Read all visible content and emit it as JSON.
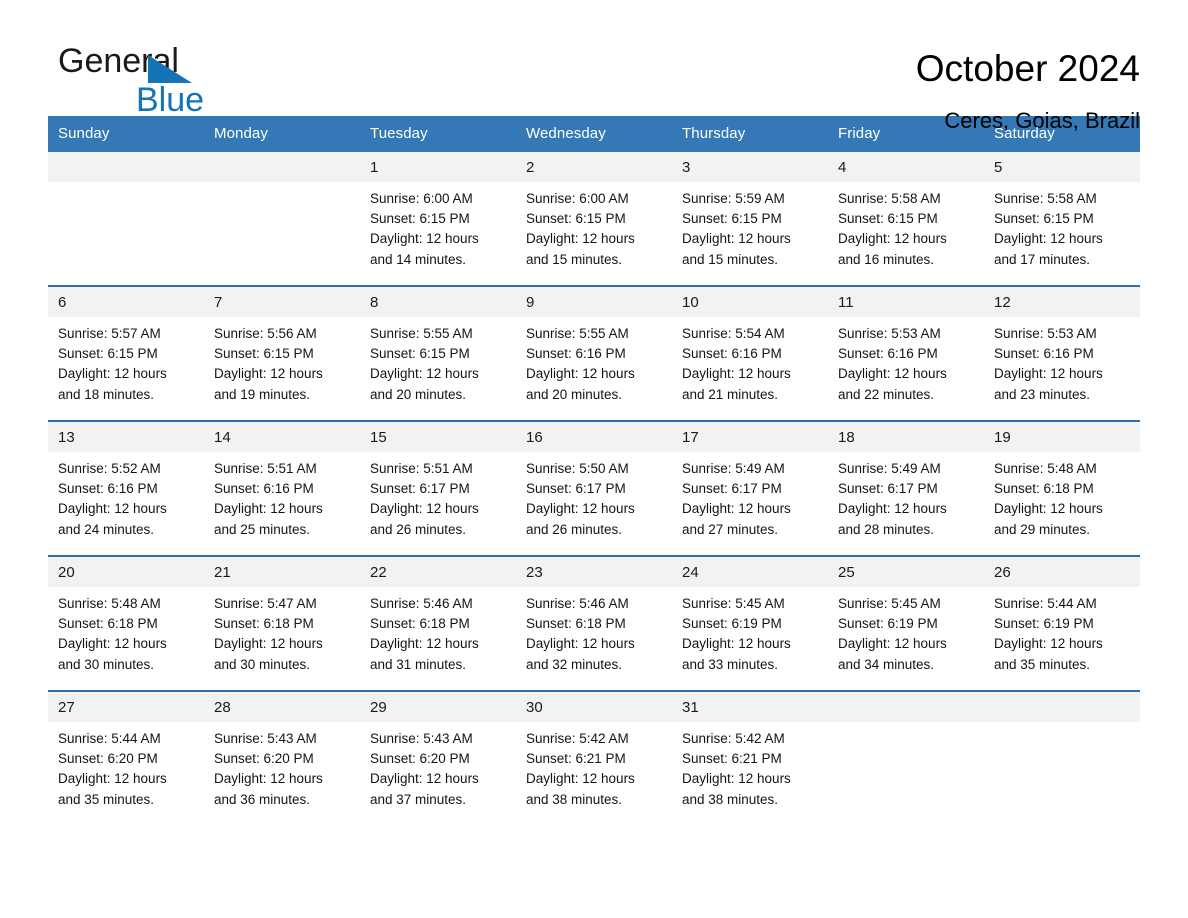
{
  "brand": {
    "name_top": "General",
    "name_bottom": "Blue",
    "triangle_color": "#1574b5",
    "text_color": "#1a1a1a"
  },
  "header": {
    "title": "October 2024",
    "subtitle": "Ceres, Goias, Brazil"
  },
  "theme": {
    "header_bg": "#3479b5",
    "header_text": "#ffffff",
    "week_rule": "#2f6fa8",
    "daynum_bg": "#f2f2f2",
    "body_text": "#141414"
  },
  "calendar": {
    "weekdays": [
      "Sunday",
      "Monday",
      "Tuesday",
      "Wednesday",
      "Thursday",
      "Friday",
      "Saturday"
    ],
    "weeks": [
      {
        "days": [
          {
            "num": "",
            "lines": []
          },
          {
            "num": "",
            "lines": []
          },
          {
            "num": "1",
            "lines": [
              "Sunrise: 6:00 AM",
              "Sunset: 6:15 PM",
              "Daylight: 12 hours",
              "and 14 minutes."
            ]
          },
          {
            "num": "2",
            "lines": [
              "Sunrise: 6:00 AM",
              "Sunset: 6:15 PM",
              "Daylight: 12 hours",
              "and 15 minutes."
            ]
          },
          {
            "num": "3",
            "lines": [
              "Sunrise: 5:59 AM",
              "Sunset: 6:15 PM",
              "Daylight: 12 hours",
              "and 15 minutes."
            ]
          },
          {
            "num": "4",
            "lines": [
              "Sunrise: 5:58 AM",
              "Sunset: 6:15 PM",
              "Daylight: 12 hours",
              "and 16 minutes."
            ]
          },
          {
            "num": "5",
            "lines": [
              "Sunrise: 5:58 AM",
              "Sunset: 6:15 PM",
              "Daylight: 12 hours",
              "and 17 minutes."
            ]
          }
        ]
      },
      {
        "days": [
          {
            "num": "6",
            "lines": [
              "Sunrise: 5:57 AM",
              "Sunset: 6:15 PM",
              "Daylight: 12 hours",
              "and 18 minutes."
            ]
          },
          {
            "num": "7",
            "lines": [
              "Sunrise: 5:56 AM",
              "Sunset: 6:15 PM",
              "Daylight: 12 hours",
              "and 19 minutes."
            ]
          },
          {
            "num": "8",
            "lines": [
              "Sunrise: 5:55 AM",
              "Sunset: 6:15 PM",
              "Daylight: 12 hours",
              "and 20 minutes."
            ]
          },
          {
            "num": "9",
            "lines": [
              "Sunrise: 5:55 AM",
              "Sunset: 6:16 PM",
              "Daylight: 12 hours",
              "and 20 minutes."
            ]
          },
          {
            "num": "10",
            "lines": [
              "Sunrise: 5:54 AM",
              "Sunset: 6:16 PM",
              "Daylight: 12 hours",
              "and 21 minutes."
            ]
          },
          {
            "num": "11",
            "lines": [
              "Sunrise: 5:53 AM",
              "Sunset: 6:16 PM",
              "Daylight: 12 hours",
              "and 22 minutes."
            ]
          },
          {
            "num": "12",
            "lines": [
              "Sunrise: 5:53 AM",
              "Sunset: 6:16 PM",
              "Daylight: 12 hours",
              "and 23 minutes."
            ]
          }
        ]
      },
      {
        "days": [
          {
            "num": "13",
            "lines": [
              "Sunrise: 5:52 AM",
              "Sunset: 6:16 PM",
              "Daylight: 12 hours",
              "and 24 minutes."
            ]
          },
          {
            "num": "14",
            "lines": [
              "Sunrise: 5:51 AM",
              "Sunset: 6:16 PM",
              "Daylight: 12 hours",
              "and 25 minutes."
            ]
          },
          {
            "num": "15",
            "lines": [
              "Sunrise: 5:51 AM",
              "Sunset: 6:17 PM",
              "Daylight: 12 hours",
              "and 26 minutes."
            ]
          },
          {
            "num": "16",
            "lines": [
              "Sunrise: 5:50 AM",
              "Sunset: 6:17 PM",
              "Daylight: 12 hours",
              "and 26 minutes."
            ]
          },
          {
            "num": "17",
            "lines": [
              "Sunrise: 5:49 AM",
              "Sunset: 6:17 PM",
              "Daylight: 12 hours",
              "and 27 minutes."
            ]
          },
          {
            "num": "18",
            "lines": [
              "Sunrise: 5:49 AM",
              "Sunset: 6:17 PM",
              "Daylight: 12 hours",
              "and 28 minutes."
            ]
          },
          {
            "num": "19",
            "lines": [
              "Sunrise: 5:48 AM",
              "Sunset: 6:18 PM",
              "Daylight: 12 hours",
              "and 29 minutes."
            ]
          }
        ]
      },
      {
        "days": [
          {
            "num": "20",
            "lines": [
              "Sunrise: 5:48 AM",
              "Sunset: 6:18 PM",
              "Daylight: 12 hours",
              "and 30 minutes."
            ]
          },
          {
            "num": "21",
            "lines": [
              "Sunrise: 5:47 AM",
              "Sunset: 6:18 PM",
              "Daylight: 12 hours",
              "and 30 minutes."
            ]
          },
          {
            "num": "22",
            "lines": [
              "Sunrise: 5:46 AM",
              "Sunset: 6:18 PM",
              "Daylight: 12 hours",
              "and 31 minutes."
            ]
          },
          {
            "num": "23",
            "lines": [
              "Sunrise: 5:46 AM",
              "Sunset: 6:18 PM",
              "Daylight: 12 hours",
              "and 32 minutes."
            ]
          },
          {
            "num": "24",
            "lines": [
              "Sunrise: 5:45 AM",
              "Sunset: 6:19 PM",
              "Daylight: 12 hours",
              "and 33 minutes."
            ]
          },
          {
            "num": "25",
            "lines": [
              "Sunrise: 5:45 AM",
              "Sunset: 6:19 PM",
              "Daylight: 12 hours",
              "and 34 minutes."
            ]
          },
          {
            "num": "26",
            "lines": [
              "Sunrise: 5:44 AM",
              "Sunset: 6:19 PM",
              "Daylight: 12 hours",
              "and 35 minutes."
            ]
          }
        ]
      },
      {
        "days": [
          {
            "num": "27",
            "lines": [
              "Sunrise: 5:44 AM",
              "Sunset: 6:20 PM",
              "Daylight: 12 hours",
              "and 35 minutes."
            ]
          },
          {
            "num": "28",
            "lines": [
              "Sunrise: 5:43 AM",
              "Sunset: 6:20 PM",
              "Daylight: 12 hours",
              "and 36 minutes."
            ]
          },
          {
            "num": "29",
            "lines": [
              "Sunrise: 5:43 AM",
              "Sunset: 6:20 PM",
              "Daylight: 12 hours",
              "and 37 minutes."
            ]
          },
          {
            "num": "30",
            "lines": [
              "Sunrise: 5:42 AM",
              "Sunset: 6:21 PM",
              "Daylight: 12 hours",
              "and 38 minutes."
            ]
          },
          {
            "num": "31",
            "lines": [
              "Sunrise: 5:42 AM",
              "Sunset: 6:21 PM",
              "Daylight: 12 hours",
              "and 38 minutes."
            ]
          },
          {
            "num": "",
            "lines": []
          },
          {
            "num": "",
            "lines": []
          }
        ]
      }
    ]
  }
}
